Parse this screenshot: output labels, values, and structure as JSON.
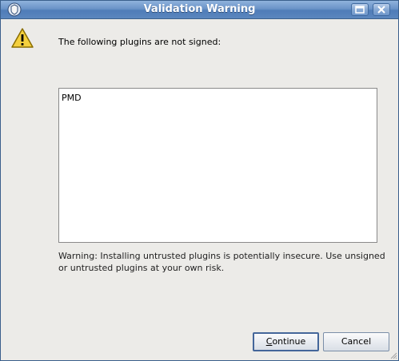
{
  "window": {
    "title": "Validation Warning",
    "icons": {
      "app": "shield-icon",
      "maximize": "maximize-icon",
      "close": "close-icon"
    }
  },
  "dialog": {
    "icon": "warning-icon",
    "message": "The following plugins are not signed:",
    "plugins": [
      "PMD"
    ],
    "warning": "Warning: Installing untrusted plugins is potentially insecure. Use unsigned or untrusted plugins at your own risk."
  },
  "buttons": {
    "continue_mnemonic": "C",
    "continue_rest": "ontinue",
    "cancel": "Cancel"
  },
  "colors": {
    "titlebar": "#5b86be",
    "background": "#ecebe8",
    "warning_yellow": "#f4d03f"
  }
}
